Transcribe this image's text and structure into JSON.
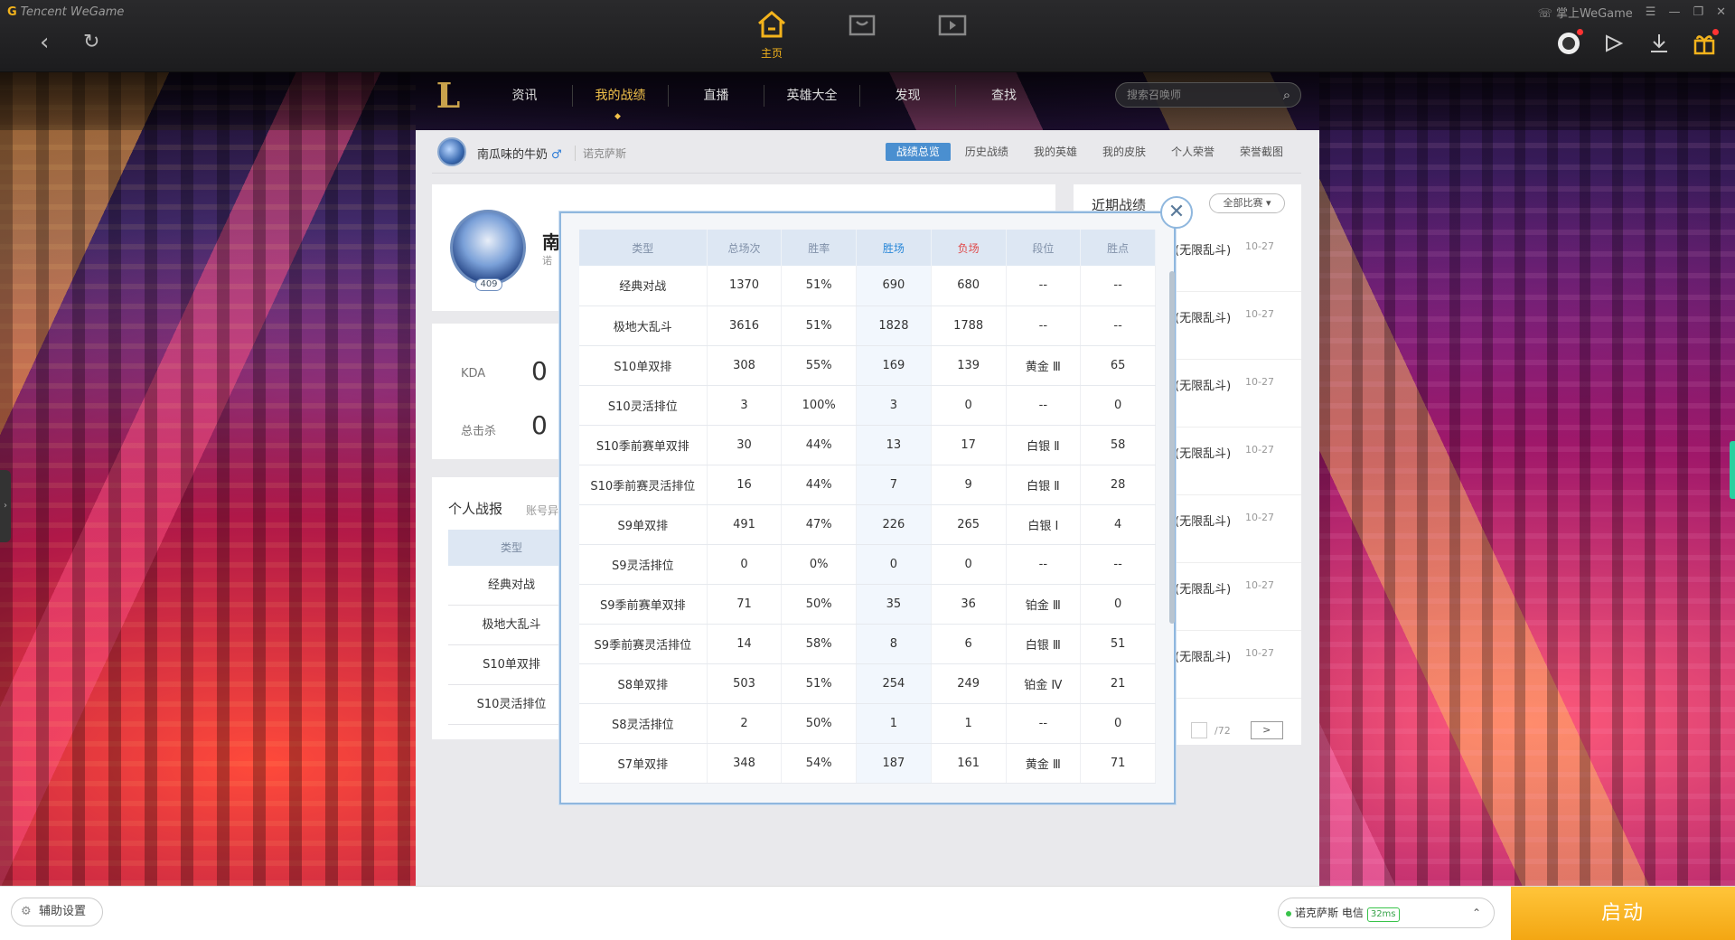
{
  "titlebar": {
    "brand": "Tencent WeGame",
    "home_label": "主页",
    "mobile_label": "掌上WeGame"
  },
  "gamenav": {
    "logo": "L",
    "tabs": [
      "资讯",
      "我的战绩",
      "直播",
      "英雄大全",
      "发现",
      "查找"
    ],
    "active_tab": "我的战绩",
    "search_placeholder": "搜索召唤师"
  },
  "profile": {
    "name": "南瓜味的牛奶",
    "gender_symbol": "♂",
    "server": "诺克萨斯",
    "big_name_initial": "南",
    "big_server_partial": "诺",
    "level": "409",
    "subtabs": [
      "战绩总览",
      "历史战绩",
      "我的英雄",
      "我的皮肤",
      "个人荣誉",
      "荣誉截图"
    ],
    "active_subtab": "战绩总览"
  },
  "stats": {
    "kda_label": "KDA",
    "kda_value": "0",
    "kills_label": "总击杀",
    "kills_value": "0"
  },
  "personal": {
    "title": "个人战报",
    "subtitle": "账号异",
    "head": "类型",
    "rows": [
      "经典对战",
      "极地大乱斗",
      "S10单双排",
      "S10灵活排位"
    ]
  },
  "recent": {
    "title": "近期战绩",
    "filter": "全部比赛",
    "items": [
      {
        "mode": "(无限乱斗)",
        "date": "10-27"
      },
      {
        "mode": "(无限乱斗)",
        "date": "10-27"
      },
      {
        "mode": "(无限乱斗)",
        "date": "10-27"
      },
      {
        "mode": "(无限乱斗)",
        "date": "10-27"
      },
      {
        "mode": "(无限乱斗)",
        "date": "10-27"
      },
      {
        "mode": "(无限乱斗)",
        "date": "10-27"
      },
      {
        "mode": "(无限乱斗)",
        "date": "10-27"
      }
    ],
    "pager_total": "/72",
    "pager_next": ">"
  },
  "modal": {
    "close": "✕",
    "headers": [
      "类型",
      "总场次",
      "胜率",
      "胜场",
      "负场",
      "段位",
      "胜点"
    ],
    "rows": [
      [
        "经典对战",
        "1370",
        "51%",
        "690",
        "680",
        "--",
        "--"
      ],
      [
        "极地大乱斗",
        "3616",
        "51%",
        "1828",
        "1788",
        "--",
        "--"
      ],
      [
        "S10单双排",
        "308",
        "55%",
        "169",
        "139",
        "黄金 Ⅲ",
        "65"
      ],
      [
        "S10灵活排位",
        "3",
        "100%",
        "3",
        "0",
        "--",
        "0"
      ],
      [
        "S10季前赛单双排",
        "30",
        "44%",
        "13",
        "17",
        "白银 Ⅱ",
        "58"
      ],
      [
        "S10季前赛灵活排位",
        "16",
        "44%",
        "7",
        "9",
        "白银 Ⅱ",
        "28"
      ],
      [
        "S9单双排",
        "491",
        "47%",
        "226",
        "265",
        "白银 Ⅰ",
        "4"
      ],
      [
        "S9灵活排位",
        "0",
        "0%",
        "0",
        "0",
        "--",
        "--"
      ],
      [
        "S9季前赛单双排",
        "71",
        "50%",
        "35",
        "36",
        "铂金 Ⅲ",
        "0"
      ],
      [
        "S9季前赛灵活排位",
        "14",
        "58%",
        "8",
        "6",
        "白银 Ⅲ",
        "51"
      ],
      [
        "S8单双排",
        "503",
        "51%",
        "254",
        "249",
        "铂金 Ⅳ",
        "21"
      ],
      [
        "S8灵活排位",
        "2",
        "50%",
        "1",
        "1",
        "--",
        "0"
      ],
      [
        "S7单双排",
        "348",
        "54%",
        "187",
        "161",
        "黄金 Ⅲ",
        "71"
      ]
    ]
  },
  "bottombar": {
    "aux_label": "辅助设置",
    "server_label": "诺克萨斯 电信",
    "ping": "32ms",
    "start_label": "启动"
  },
  "colors": {
    "accent": "#f3c24a",
    "win": "#2a88d8",
    "lose": "#e04a4a",
    "start": "#f3a612"
  }
}
